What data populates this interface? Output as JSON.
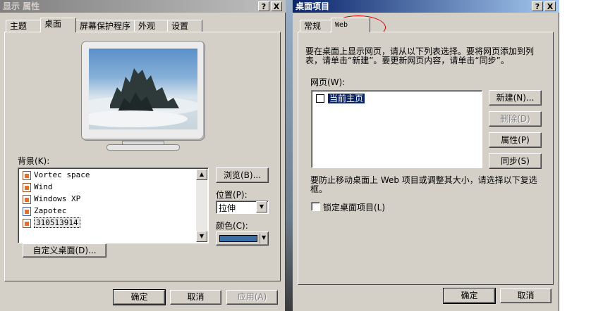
{
  "left_dialog": {
    "title": "显示 属性",
    "help_btn": "?",
    "close_btn": "X",
    "tabs": [
      "主题",
      "桌面",
      "屏幕保护程序",
      "外观",
      "设置"
    ],
    "background_label": "背景(K):",
    "background_items": [
      "Vortec space",
      "Wind",
      "Windows XP",
      "Zapotec",
      "310513914"
    ],
    "browse_button": "浏览(B)...",
    "position_label": "位置(P):",
    "position_value": "拉伸",
    "color_label": "颜色(C):",
    "color_value": "#3a6ea5",
    "customize_button": "自定义桌面(D)...",
    "ok_button": "确定",
    "cancel_button": "取消",
    "apply_button": "应用(A)"
  },
  "right_dialog": {
    "title": "桌面项目",
    "help_btn": "?",
    "close_btn": "X",
    "tabs": [
      "常规",
      "Web"
    ],
    "instructions_line1": "要在桌面上显示网页，请从以下列表选择。要将网页添加到列",
    "instructions_line2": "表，请单击“新建”。要更新网页内容，请单击“同步”。",
    "webpages_label": "网页(W):",
    "webpage_item": "当前主页",
    "new_button": "新建(N)...",
    "delete_button": "删除(D)",
    "properties_button": "属性(P)",
    "sync_button": "同步(S)",
    "lock_text_line1": "要防止移动桌面上 Web 项目或调整其大小，请选择以下复选",
    "lock_text_line2": "框。",
    "lock_checkbox_label": "锁定桌面项目(L)",
    "ok_button": "确定",
    "cancel_button": "取消"
  },
  "colors": {
    "dialog_bg": "#d4d0c8",
    "titlebar_active": "#0a246a",
    "annotation_red": "#e00000"
  }
}
